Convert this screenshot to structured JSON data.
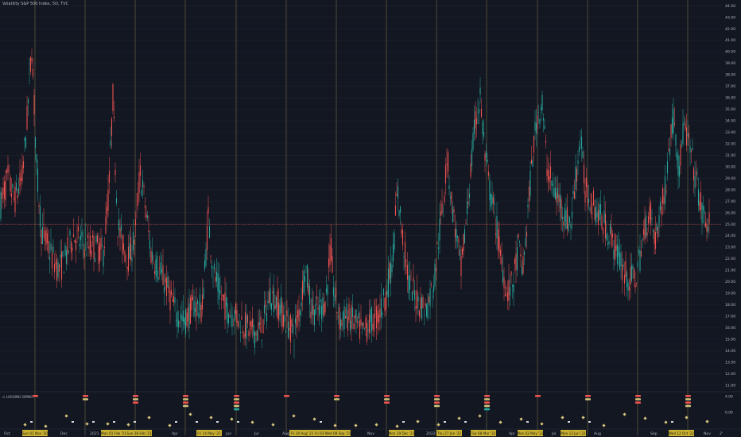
{
  "header": {
    "title": "Volatility S&P 500 Index, 5D, TVC"
  },
  "indicator": {
    "label": "⊙ LAGGING SWING"
  },
  "colors": {
    "background": "#131722",
    "grid": "#1e2230",
    "up": "#26a69a",
    "down": "#ef5350",
    "vline": "#8a7f4a",
    "hline": "#ef5350",
    "price_tag": "#ef5350",
    "date_tag": "#c9b02e",
    "marker_yellow": "#d4c27a"
  },
  "chart_data": {
    "type": "candlestick",
    "title": "Volatility S&P 500 Index, 5D, TVC",
    "ylim": [
      10.5,
      44.5
    ],
    "yticks": [
      "11.00",
      "12.00",
      "13.00",
      "14.00",
      "15.00",
      "16.00",
      "17.00",
      "18.00",
      "19.00",
      "20.00",
      "21.00",
      "22.00",
      "23.00",
      "24.00",
      "25.00",
      "26.00",
      "27.00",
      "28.00",
      "29.00",
      "30.00",
      "31.00",
      "32.00",
      "33.00",
      "34.00",
      "35.00",
      "36.00",
      "37.00",
      "38.00",
      "39.00",
      "40.00",
      "41.00",
      "42.00",
      "43.00",
      "44.00"
    ],
    "current_price": 25.0,
    "current_price_label": "25.18",
    "time_axis": [
      "Oct",
      "Dec",
      "2021",
      "Apr",
      "Jun",
      "Jul",
      "Aug",
      "Nov",
      "2022",
      "Apr",
      "Jul",
      "Aug",
      "Sep",
      "Nov",
      "2'"
    ],
    "date_labels": [
      "Sun 01 Nov '20",
      "Mon 01 Feb '21",
      "Sun 28 Feb '21",
      "Fri 14 May '21",
      "Fri 20 Aug '21",
      "Fri 03 Sep '21",
      "Wed 08 Sep '21",
      "Mon 29 Dec '21",
      "Thu 27 Jan '22",
      "Tue 08 Mar '22",
      "Mon 02 May '22",
      "Mon 13 Jun '22",
      "Wed 12 Oct '22"
    ],
    "indicator_axis": [
      "4.00",
      "0.00"
    ],
    "guide_line_count": 14,
    "anchors": [
      [
        0,
        26.5
      ],
      [
        10,
        29.0
      ],
      [
        18,
        27.0
      ],
      [
        28,
        29.0
      ],
      [
        34,
        34.0
      ],
      [
        40,
        40.5
      ],
      [
        46,
        30.0
      ],
      [
        52,
        24.5
      ],
      [
        58,
        23.5
      ],
      [
        66,
        22.0
      ],
      [
        74,
        21.0
      ],
      [
        82,
        22.0
      ],
      [
        92,
        24.0
      ],
      [
        100,
        23.5
      ],
      [
        110,
        23.0
      ],
      [
        120,
        23.0
      ],
      [
        130,
        22.5
      ],
      [
        137,
        28.0
      ],
      [
        142,
        36.0
      ],
      [
        148,
        25.0
      ],
      [
        155,
        23.0
      ],
      [
        162,
        22.0
      ],
      [
        170,
        24.0
      ],
      [
        176,
        29.5
      ],
      [
        182,
        27.0
      ],
      [
        190,
        22.5
      ],
      [
        200,
        21.0
      ],
      [
        210,
        19.5
      ],
      [
        220,
        17.5
      ],
      [
        232,
        16.5
      ],
      [
        244,
        18.0
      ],
      [
        254,
        17.5
      ],
      [
        262,
        25.5
      ],
      [
        268,
        21.0
      ],
      [
        276,
        19.0
      ],
      [
        286,
        17.5
      ],
      [
        298,
        17.0
      ],
      [
        310,
        16.0
      ],
      [
        320,
        15.5
      ],
      [
        330,
        16.0
      ],
      [
        340,
        19.0
      ],
      [
        350,
        18.0
      ],
      [
        360,
        16.5
      ],
      [
        370,
        15.5
      ],
      [
        378,
        18.0
      ],
      [
        384,
        21.5
      ],
      [
        392,
        17.5
      ],
      [
        402,
        17.5
      ],
      [
        410,
        18.5
      ],
      [
        416,
        23.0
      ],
      [
        420,
        19.0
      ],
      [
        428,
        16.5
      ],
      [
        436,
        17.0
      ],
      [
        446,
        16.5
      ],
      [
        456,
        15.5
      ],
      [
        466,
        16.5
      ],
      [
        476,
        17.0
      ],
      [
        486,
        19.0
      ],
      [
        494,
        22.0
      ],
      [
        500,
        28.0
      ],
      [
        506,
        24.0
      ],
      [
        514,
        20.0
      ],
      [
        524,
        18.5
      ],
      [
        536,
        17.5
      ],
      [
        546,
        20.0
      ],
      [
        552,
        24.0
      ],
      [
        558,
        27.0
      ],
      [
        562,
        31.0
      ],
      [
        568,
        27.0
      ],
      [
        574,
        24.0
      ],
      [
        580,
        21.0
      ],
      [
        586,
        25.0
      ],
      [
        592,
        29.5
      ],
      [
        598,
        34.0
      ],
      [
        604,
        36.0
      ],
      [
        610,
        31.0
      ],
      [
        616,
        28.0
      ],
      [
        624,
        25.0
      ],
      [
        630,
        22.0
      ],
      [
        638,
        19.0
      ],
      [
        646,
        20.0
      ],
      [
        652,
        23.0
      ],
      [
        658,
        21.0
      ],
      [
        664,
        26.0
      ],
      [
        670,
        31.0
      ],
      [
        676,
        34.5
      ],
      [
        682,
        35.5
      ],
      [
        688,
        30.0
      ],
      [
        696,
        28.0
      ],
      [
        704,
        27.0
      ],
      [
        712,
        25.5
      ],
      [
        718,
        25.0
      ],
      [
        724,
        29.0
      ],
      [
        730,
        32.5
      ],
      [
        736,
        28.0
      ],
      [
        744,
        27.0
      ],
      [
        752,
        26.0
      ],
      [
        760,
        25.0
      ],
      [
        768,
        24.0
      ],
      [
        776,
        22.5
      ],
      [
        784,
        21.0
      ],
      [
        792,
        20.0
      ],
      [
        800,
        20.5
      ],
      [
        806,
        22.5
      ],
      [
        812,
        25.0
      ],
      [
        818,
        26.0
      ],
      [
        824,
        23.5
      ],
      [
        830,
        26.0
      ],
      [
        836,
        27.5
      ],
      [
        842,
        32.0
      ],
      [
        848,
        34.5
      ],
      [
        854,
        29.5
      ],
      [
        860,
        33.5
      ],
      [
        866,
        32.0
      ],
      [
        872,
        30.0
      ],
      [
        878,
        28.0
      ],
      [
        884,
        25.5
      ],
      [
        891,
        25.0
      ]
    ]
  }
}
